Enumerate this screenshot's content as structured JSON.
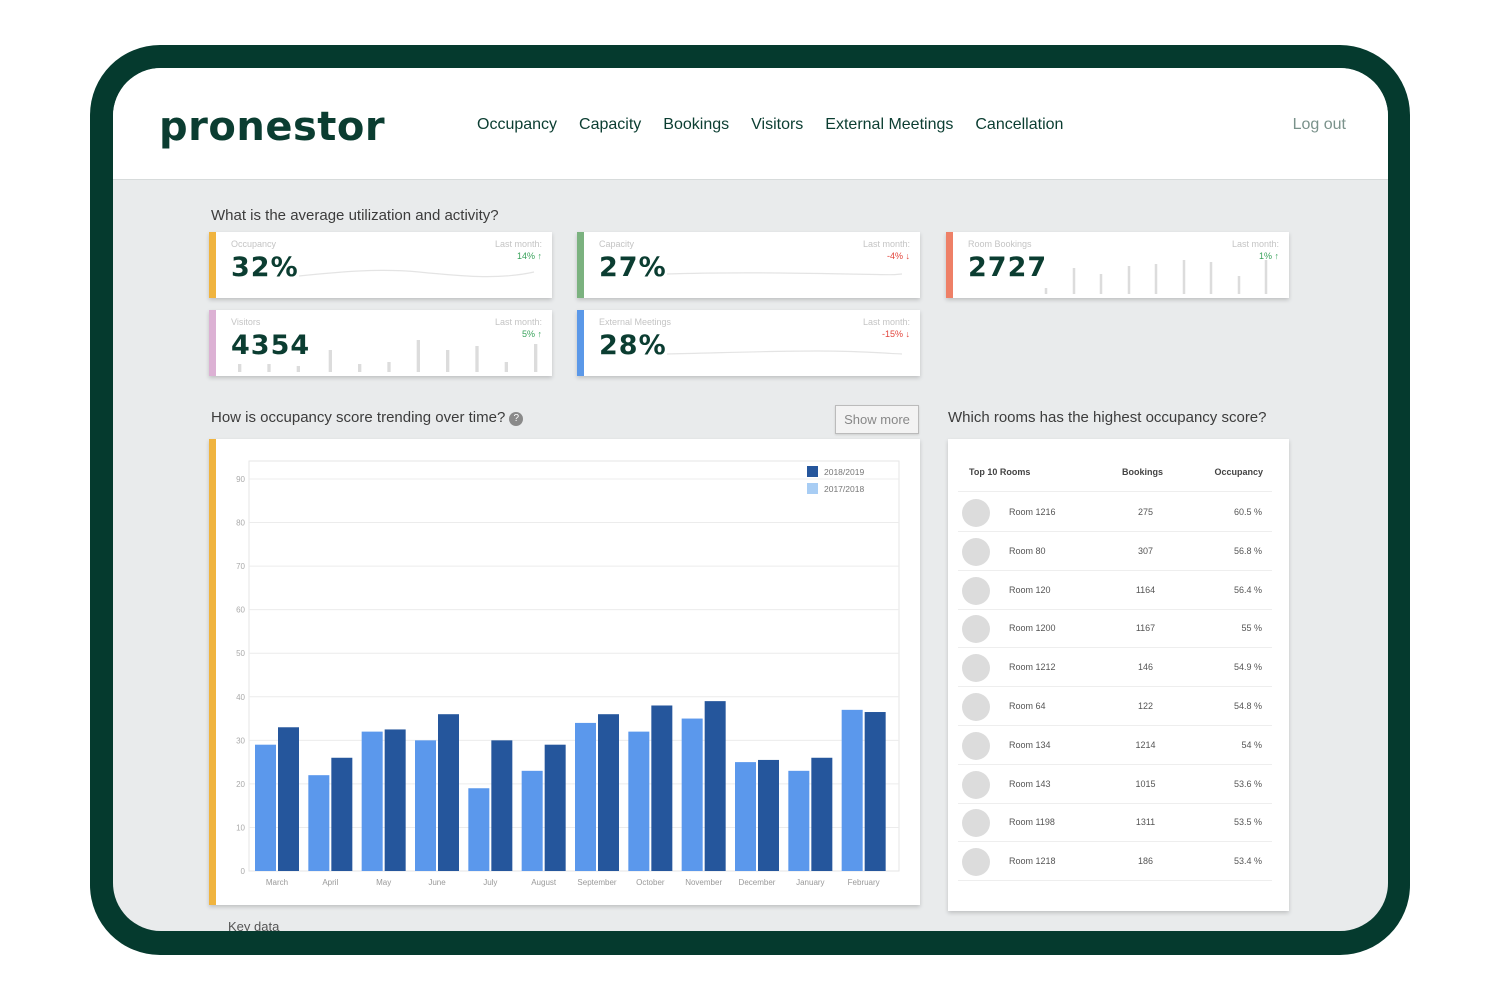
{
  "app": {
    "logo": "pronestor"
  },
  "nav": {
    "items": [
      "Occupancy",
      "Capacity",
      "Bookings",
      "Visitors",
      "External Meetings",
      "Cancellation"
    ],
    "logout": "Log out"
  },
  "questions": {
    "utilization": "What is the average utilization and activity?",
    "trend": "How is occupancy score trending over time?",
    "rooms": "Which rooms has the highest occupancy score?",
    "key_data": "Key data"
  },
  "show_more": "Show more",
  "colors": {
    "brand": "#053a2e",
    "occupancy": "#f0b43f",
    "capacity": "#7bb27f",
    "bookings": "#ee8067",
    "visitors": "#dcb1d4",
    "external": "#5b98e8",
    "series_2018": "#25569c",
    "series_2017": "#5b98ec",
    "up": "#3aa35c",
    "down": "#e2453c"
  },
  "kpis": [
    {
      "label": "Occupancy",
      "value": "32%",
      "last_month_label": "Last month:",
      "change": "14%",
      "dir": "up",
      "color": "#f0b43f",
      "spark": "line"
    },
    {
      "label": "Capacity",
      "value": "27%",
      "last_month_label": "Last month:",
      "change": "-4%",
      "dir": "down",
      "color": "#7bb27f",
      "spark": "line"
    },
    {
      "label": "Room Bookings",
      "value": "2727",
      "last_month_label": "Last month:",
      "change": "1%",
      "dir": "up",
      "color": "#ee8067",
      "spark": "bars"
    },
    {
      "label": "Visitors",
      "value": "4354",
      "last_month_label": "Last month:",
      "change": "5%",
      "dir": "up",
      "color": "#dcb1d4",
      "spark": "bars"
    },
    {
      "label": "External Meetings",
      "value": "28%",
      "last_month_label": "Last month:",
      "change": "-15%",
      "dir": "down",
      "color": "#5b98e8",
      "spark": "line"
    }
  ],
  "chart_data": {
    "type": "bar",
    "categories": [
      "March",
      "April",
      "May",
      "June",
      "July",
      "August",
      "September",
      "October",
      "November",
      "December",
      "January",
      "February"
    ],
    "series": [
      {
        "name": "2017/2018",
        "values": [
          29,
          22,
          32,
          30,
          19,
          23,
          34,
          32,
          35,
          25,
          23,
          37
        ]
      },
      {
        "name": "2018/2019",
        "values": [
          33,
          26,
          32.5,
          36,
          30,
          29,
          36,
          38,
          39,
          25.5,
          26,
          36.5
        ]
      }
    ],
    "yticks": [
      0,
      10,
      20,
      30,
      40,
      50,
      60,
      70,
      80,
      90
    ],
    "ylim": [
      0,
      90
    ],
    "legend": "top-right",
    "grid": true
  },
  "rooms_table": {
    "headers": {
      "room": "Top 10 Rooms",
      "bookings": "Bookings",
      "occupancy": "Occupancy"
    },
    "rows": [
      {
        "name": "Room 1216",
        "bookings": "275",
        "occupancy": "60.5 %"
      },
      {
        "name": "Room 80",
        "bookings": "307",
        "occupancy": "56.8 %"
      },
      {
        "name": "Room 120",
        "bookings": "1164",
        "occupancy": "56.4 %"
      },
      {
        "name": "Room 1200",
        "bookings": "1167",
        "occupancy": "55 %"
      },
      {
        "name": "Room 1212",
        "bookings": "146",
        "occupancy": "54.9 %"
      },
      {
        "name": "Room 64",
        "bookings": "122",
        "occupancy": "54.8 %"
      },
      {
        "name": "Room 134",
        "bookings": "1214",
        "occupancy": "54 %"
      },
      {
        "name": "Room 143",
        "bookings": "1015",
        "occupancy": "53.6 %"
      },
      {
        "name": "Room 1198",
        "bookings": "1311",
        "occupancy": "53.5 %"
      },
      {
        "name": "Room 1218",
        "bookings": "186",
        "occupancy": "53.4 %"
      }
    ]
  }
}
